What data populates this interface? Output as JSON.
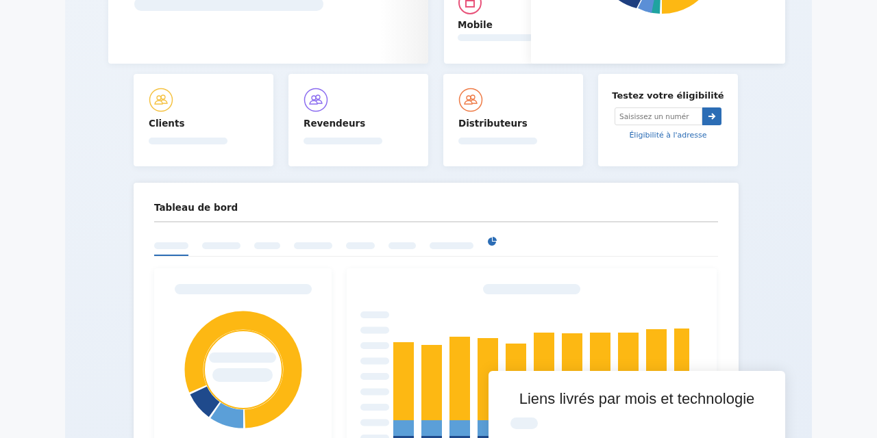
{
  "top_cards": [
    {
      "label": "Mobile",
      "color": "#e8537a"
    }
  ],
  "segment_cards": [
    {
      "label": "Clients",
      "color": "#f5c242"
    },
    {
      "label": "Revendeurs",
      "color": "#8b6cf0"
    },
    {
      "label": "Distributeurs",
      "color": "#ee7a45"
    }
  ],
  "eligibility": {
    "title": "Testez votre éligibilité",
    "placeholder": "Saisissez un numér",
    "link": "Éligibilité à l'adresse"
  },
  "dashboard": {
    "title": "Tableau de bord",
    "tabs": [
      {
        "kind": "bar",
        "selected": true
      },
      {
        "kind": "bar",
        "selected": false
      },
      {
        "kind": "bar",
        "selected": false
      },
      {
        "kind": "bar",
        "selected": false
      },
      {
        "kind": "bar",
        "selected": false
      },
      {
        "kind": "bar",
        "selected": false
      },
      {
        "kind": "bar",
        "selected": false
      },
      {
        "kind": "icon",
        "selected": false
      }
    ]
  },
  "overlay_card": {
    "title": "Liens livrés par mois et technologie"
  }
}
